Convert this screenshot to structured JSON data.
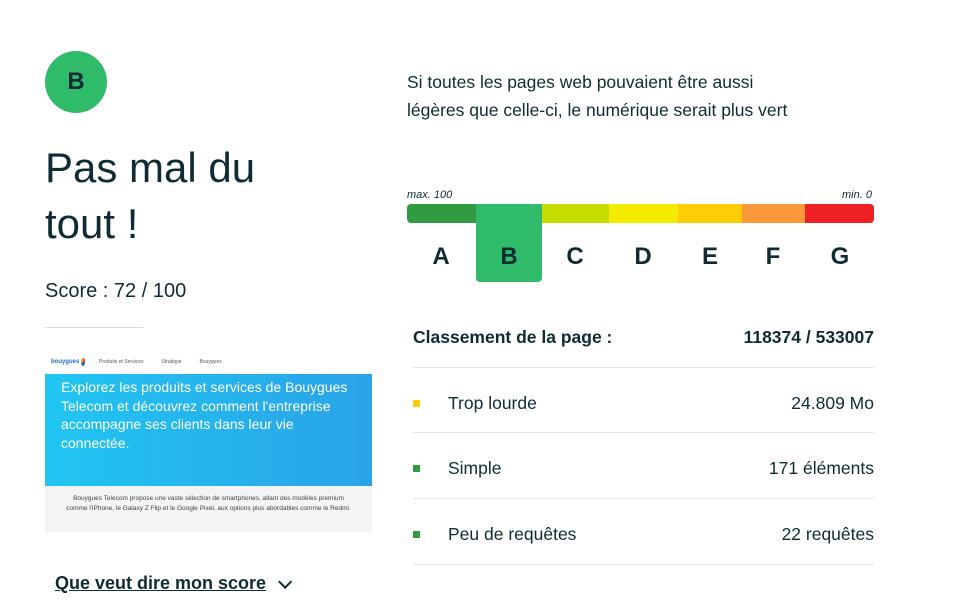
{
  "grade_badge": "B",
  "headline": "Pas mal du tout !",
  "score_text": "Score : 72 / 100",
  "score": {
    "value": 72,
    "max": 100
  },
  "tagline": "Si toutes les pages web pouvaient être aussi légères que celle-ci, le numérique serait plus vert",
  "scale": {
    "max_label": "max. 100",
    "min_label": "min. 0",
    "selected": "B",
    "grades": [
      {
        "label": "A",
        "color": "#319b42"
      },
      {
        "label": "B",
        "color": "#2fbb6a"
      },
      {
        "label": "C",
        "color": "#c6dd00"
      },
      {
        "label": "D",
        "color": "#f4ec00"
      },
      {
        "label": "E",
        "color": "#fecd06"
      },
      {
        "label": "F",
        "color": "#f99839"
      },
      {
        "label": "G",
        "color": "#ed2124"
      }
    ]
  },
  "thumbnail": {
    "logo_text": "bouygues",
    "nav": [
      "Produits et Services",
      "Stratégie",
      "Bouygues"
    ],
    "hero": "Explorez les produits et services de Bouygues Telecom et découvrez comment l'entreprise accompagne ses clients dans leur vie connectée.",
    "footer": "Bouygues Telecom propose une vaste sélection de smartphones, allant des modèles premium comme l'iPhone, le Galaxy Z Flip et le Google Pixel, aux options plus abordables comme le Redmi."
  },
  "ranking": {
    "label": "Classement de la page :",
    "value": "118374 / 533007"
  },
  "metrics": [
    {
      "label": "Trop lourde",
      "value": "24.809 Mo",
      "color": "#fecd06"
    },
    {
      "label": "Simple",
      "value": "171 éléments",
      "color": "#319b42"
    },
    {
      "label": "Peu de requêtes",
      "value": "22 requêtes",
      "color": "#319b42"
    }
  ],
  "link_label": "Que veut dire mon score"
}
